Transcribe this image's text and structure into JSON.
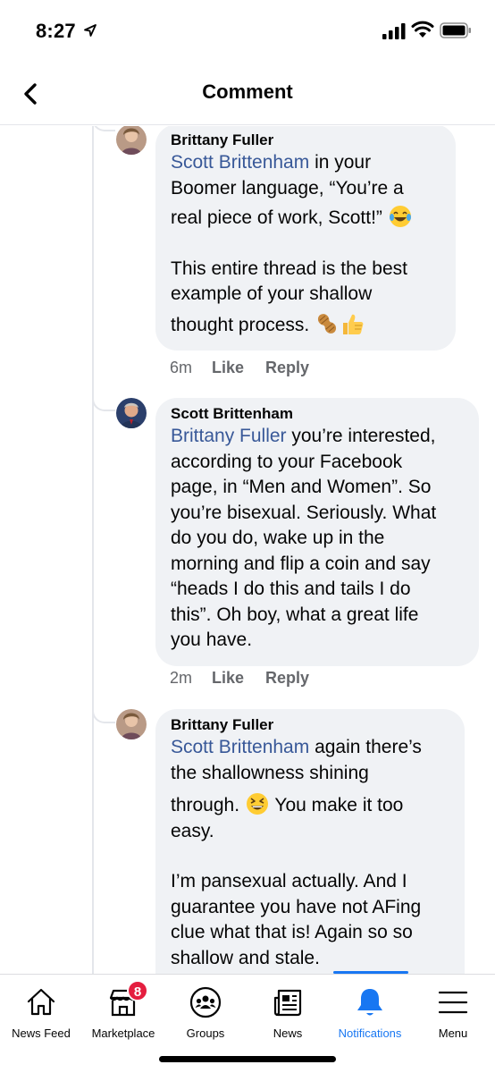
{
  "status_bar": {
    "time": "8:27"
  },
  "header": {
    "title": "Comment"
  },
  "comments": [
    {
      "author": "Brittany Fuller",
      "mention": "Scott Brittenham",
      "lines_first": [
        " in your",
        "Boomer language, “You’re a",
        "real piece of work, Scott!”"
      ],
      "lines_second": [
        "This entire thread is the best",
        "example of your shallow",
        "thought process."
      ],
      "time": "6m",
      "like_label": "Like",
      "reply_label": "Reply"
    },
    {
      "author": "Scott Brittenham",
      "mention": "Brittany Fuller",
      "lines_first": [
        " you’re interested,",
        "according to your Facebook",
        "page, in “Men and Women”. So",
        "you’re bisexual. Seriously. What",
        "do you do, wake up in the",
        "morning and flip a coin and say",
        "“heads I do this and tails I do",
        "this”. Oh boy, what a great life",
        "you have."
      ],
      "time": "2m",
      "like_label": "Like",
      "reply_label": "Reply"
    },
    {
      "author": "Brittany Fuller",
      "mention": "Scott Brittenham",
      "lines_first": [
        " again there’s",
        "the shallowness shining",
        "through.",
        " You make it too",
        "easy."
      ],
      "lines_second": [
        "I’m pansexual actually. And I",
        "guarantee you have not AFing",
        "clue what that is! Again so so",
        "shallow and stale."
      ]
    }
  ],
  "bottom_nav": {
    "items": [
      {
        "label": "News Feed",
        "icon": "home-icon"
      },
      {
        "label": "Marketplace",
        "icon": "marketplace-icon",
        "badge": "8"
      },
      {
        "label": "Groups",
        "icon": "groups-icon"
      },
      {
        "label": "News",
        "icon": "news-icon"
      },
      {
        "label": "Notifications",
        "icon": "bell-icon",
        "active": true
      },
      {
        "label": "Menu",
        "icon": "menu-icon"
      }
    ]
  },
  "colors": {
    "accent": "#1877f2",
    "mention": "#385898",
    "bubble": "#f0f2f5",
    "meta": "#65676b",
    "badge": "#e41e3f"
  }
}
